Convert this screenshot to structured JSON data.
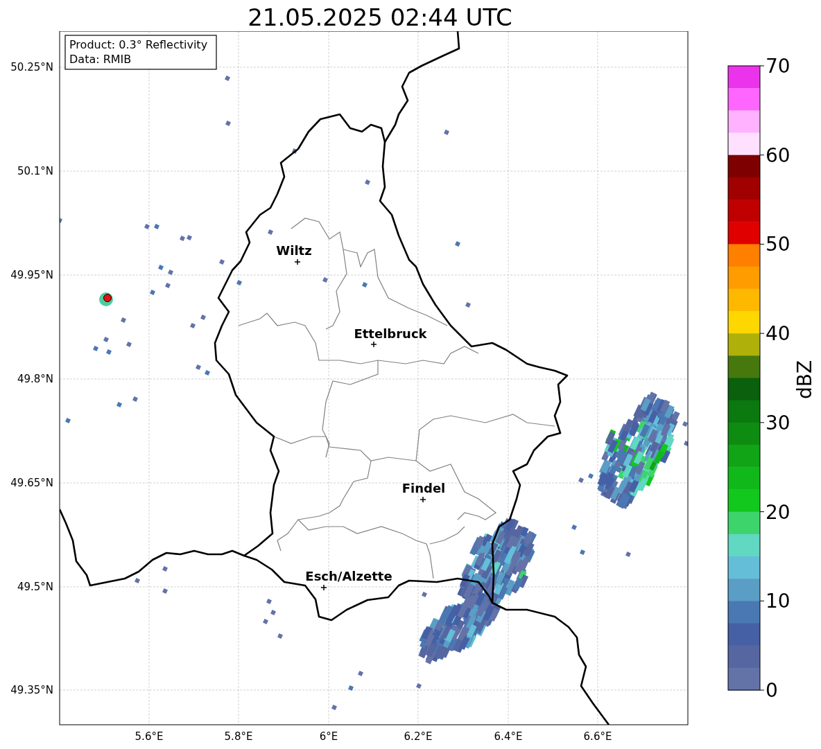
{
  "title": "21.05.2025 02:44 UTC",
  "info_box": {
    "lines": [
      "Product: 0.3° Reflectivity",
      "Data: RMIB"
    ]
  },
  "map": {
    "x_ticks": [
      "5.6°E",
      "5.8°E",
      "6°E",
      "6.2°E",
      "6.4°E",
      "6.6°E"
    ],
    "y_ticks": [
      "50.25°N",
      "50.1°N",
      "49.95°N",
      "49.8°N",
      "49.65°N",
      "49.5°N",
      "49.35°N"
    ],
    "cities": [
      {
        "name": "Wiltz"
      },
      {
        "name": "Ettelbruck"
      },
      {
        "name": "Findel"
      },
      {
        "name": "Esch/Alzette"
      }
    ]
  },
  "colorbar": {
    "label": "dBZ",
    "ticks": [
      "70",
      "60",
      "50",
      "40",
      "30",
      "20",
      "10",
      "0"
    ],
    "segments": [
      {
        "color": "#ea33ea"
      },
      {
        "color": "#ff66ff"
      },
      {
        "color": "#ffb2ff"
      },
      {
        "color": "#ffe0ff"
      },
      {
        "color": "#7f0000"
      },
      {
        "color": "#a00000"
      },
      {
        "color": "#c00000"
      },
      {
        "color": "#e00000"
      },
      {
        "color": "#ff7f00"
      },
      {
        "color": "#ff9c00"
      },
      {
        "color": "#ffb800"
      },
      {
        "color": "#ffd700"
      },
      {
        "color": "#b0b00a"
      },
      {
        "color": "#46780e"
      },
      {
        "color": "#0a600c"
      },
      {
        "color": "#0c7810"
      },
      {
        "color": "#0e8c12"
      },
      {
        "color": "#10a416"
      },
      {
        "color": "#10b81a"
      },
      {
        "color": "#12c81c"
      },
      {
        "color": "#3ed46c"
      },
      {
        "color": "#60d8c2"
      },
      {
        "color": "#64bed8"
      },
      {
        "color": "#5a9ec6"
      },
      {
        "color": "#4a78b2"
      },
      {
        "color": "#4660a6"
      },
      {
        "color": "#5666a0"
      },
      {
        "color": "#6373a8"
      }
    ]
  }
}
